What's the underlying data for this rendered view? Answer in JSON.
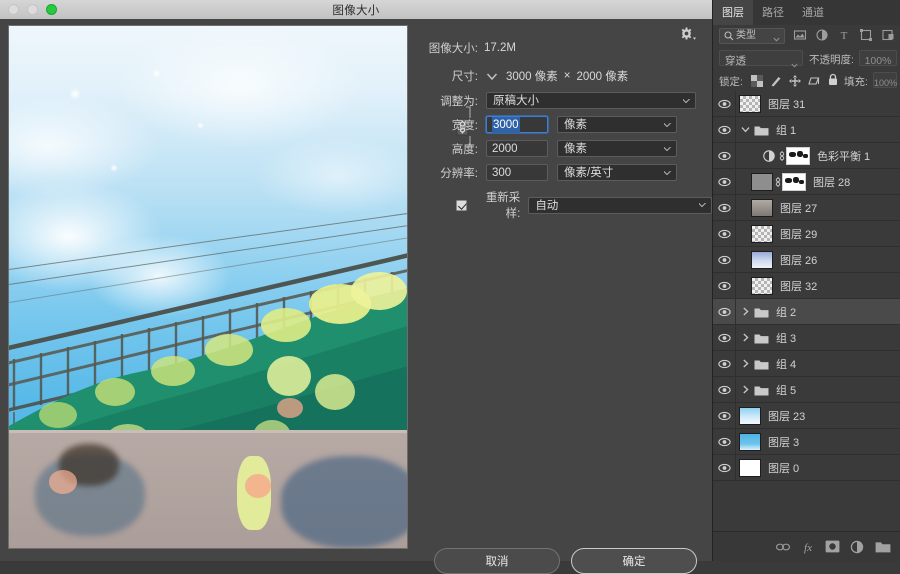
{
  "window": {
    "title": "图像大小",
    "traffic_lights": [
      "close",
      "minimize",
      "maximize"
    ]
  },
  "dialog": {
    "image_size": {
      "label": "图像大小:",
      "value": "17.2M"
    },
    "dimensions": {
      "label": "尺寸:",
      "width": "3000 像素",
      "separator": "×",
      "height": "2000 像素"
    },
    "fit_to": {
      "label": "调整为:",
      "value": "原稿大小"
    },
    "width": {
      "label": "宽度:",
      "value": "3000",
      "unit": "像素"
    },
    "height": {
      "label": "高度:",
      "value": "2000",
      "unit": "像素"
    },
    "resolution": {
      "label": "分辨率:",
      "value": "300",
      "unit": "像素/英寸"
    },
    "resample": {
      "label": "重新采样:",
      "value": "自动",
      "checked": true
    },
    "constrain_icon": "chain-link-icon",
    "gear_icon": "gear-icon",
    "buttons": {
      "cancel": "取消",
      "ok": "确定"
    }
  },
  "panel": {
    "tabs": [
      {
        "label": "图层",
        "active": true
      },
      {
        "label": "路径",
        "active": false
      },
      {
        "label": "通道",
        "active": false
      }
    ],
    "filter": {
      "kind_label": "类型",
      "search_icon": "search-icon",
      "icons": [
        "image-filter-icon",
        "adjustment-filter-icon",
        "text-filter-icon",
        "shape-filter-icon",
        "smartobject-filter-icon"
      ],
      "toggle_icon": "filter-toggle-icon"
    },
    "blend": {
      "mode": "穿透",
      "opacity_label": "不透明度:",
      "opacity_value": "100%"
    },
    "lock": {
      "label": "锁定:",
      "icons": [
        "lock-transparency-icon",
        "lock-image-icon",
        "lock-position-icon",
        "lock-artboard-icon",
        "lock-all-icon"
      ],
      "fill_label": "填充:",
      "fill_value": "100%"
    },
    "layers": [
      {
        "name": "图层 31",
        "type": "pixel",
        "indent": 0,
        "selected": false,
        "visible": true,
        "thumb": "transparent"
      },
      {
        "name": "组 1",
        "type": "group",
        "indent": 0,
        "selected": false,
        "visible": true,
        "expanded": true
      },
      {
        "name": "色彩平衡 1",
        "type": "adjustment",
        "indent": 1,
        "selected": false,
        "visible": true,
        "thumb": "mask-dark"
      },
      {
        "name": "图层 28",
        "type": "masked",
        "indent": 1,
        "selected": false,
        "visible": true,
        "thumb": "grey"
      },
      {
        "name": "图层 27",
        "type": "pixel",
        "indent": 1,
        "selected": false,
        "visible": true,
        "thumb": "grey-art"
      },
      {
        "name": "图层 29",
        "type": "pixel",
        "indent": 1,
        "selected": false,
        "visible": true,
        "thumb": "transparent"
      },
      {
        "name": "图层 26",
        "type": "pixel",
        "indent": 1,
        "selected": false,
        "visible": true,
        "thumb": "blue-art"
      },
      {
        "name": "图层 32",
        "type": "pixel",
        "indent": 1,
        "selected": false,
        "visible": true,
        "thumb": "transparent"
      },
      {
        "name": "组 2",
        "type": "group",
        "indent": 0,
        "selected": true,
        "visible": true,
        "expanded": false
      },
      {
        "name": "组 3",
        "type": "group",
        "indent": 0,
        "selected": false,
        "visible": true,
        "expanded": false
      },
      {
        "name": "组 4",
        "type": "group",
        "indent": 0,
        "selected": false,
        "visible": true,
        "expanded": false
      },
      {
        "name": "组 5",
        "type": "group",
        "indent": 0,
        "selected": false,
        "visible": true,
        "expanded": false
      },
      {
        "name": "图层 23",
        "type": "pixel",
        "indent": 0,
        "selected": false,
        "visible": true,
        "thumb": "sky-art"
      },
      {
        "name": "图层 3",
        "type": "pixel",
        "indent": 0,
        "selected": false,
        "visible": true,
        "thumb": "sky-solid"
      },
      {
        "name": "图层 0",
        "type": "pixel",
        "indent": 0,
        "selected": false,
        "visible": true,
        "thumb": "white"
      }
    ],
    "bottom_icons": [
      "link-layers-icon",
      "layer-fx-icon",
      "add-mask-icon",
      "new-adjustment-icon",
      "new-group-icon"
    ]
  },
  "colors": {
    "dialog_bg": "#454545",
    "panel_bg": "#323232",
    "list_bg": "#3a3a3a",
    "selected_row": "#4a4a4a",
    "accent_blue": "#2f63a8",
    "text": "#d2d2d2"
  }
}
